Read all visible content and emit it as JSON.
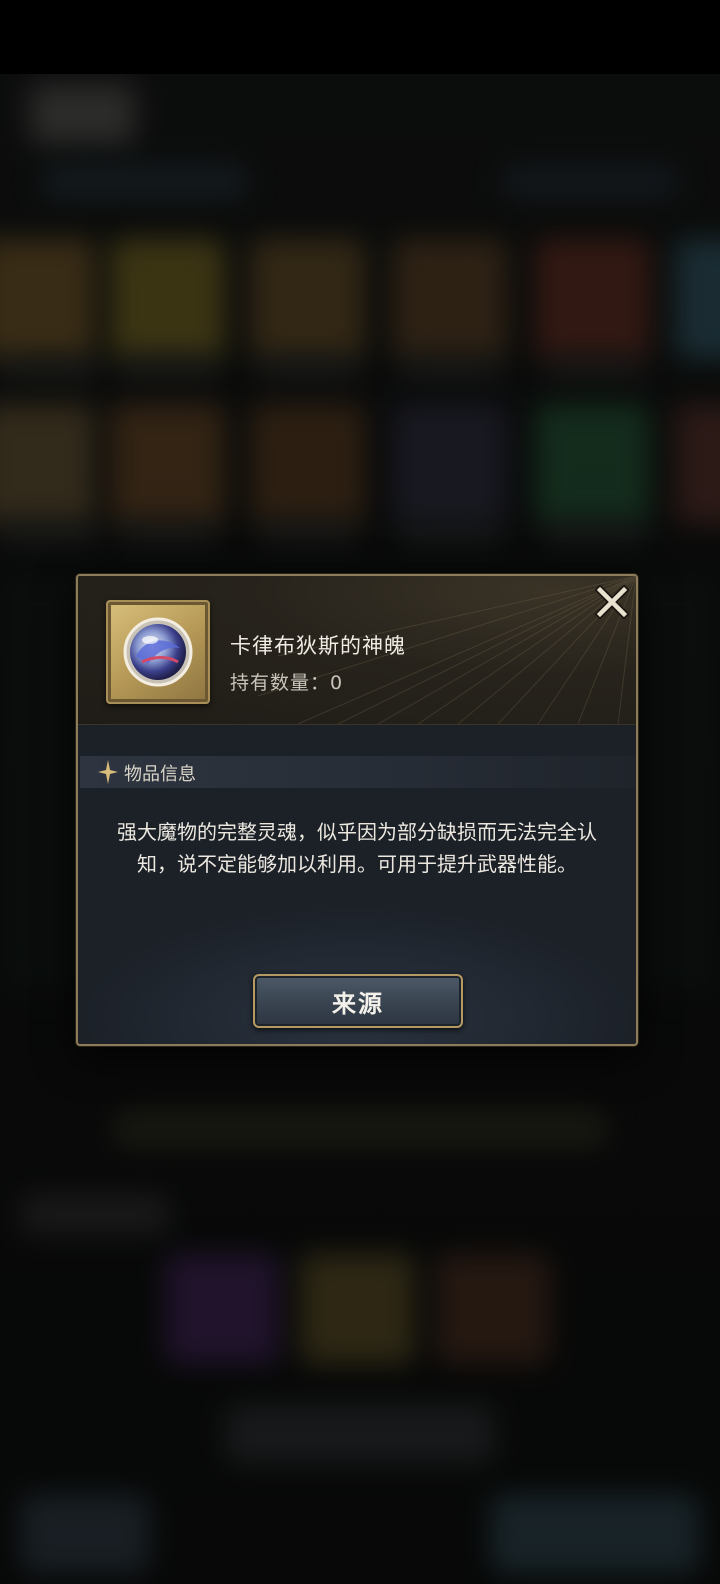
{
  "item": {
    "name": "卡律布狄斯的神魄",
    "count_label": "持有数量：",
    "count_value": "0"
  },
  "section": {
    "label": "物品信息"
  },
  "description": "强大魔物的完整灵魂，似乎因为部分缺损而无法完全认知，说不定能够加以利用。可用于提升武器性能。",
  "buttons": {
    "source_label": "来源"
  },
  "colors": {
    "frame_gold": "#8d7c5a",
    "text_primary": "#f0ece4",
    "accent_gold": "#d8bd7a"
  }
}
